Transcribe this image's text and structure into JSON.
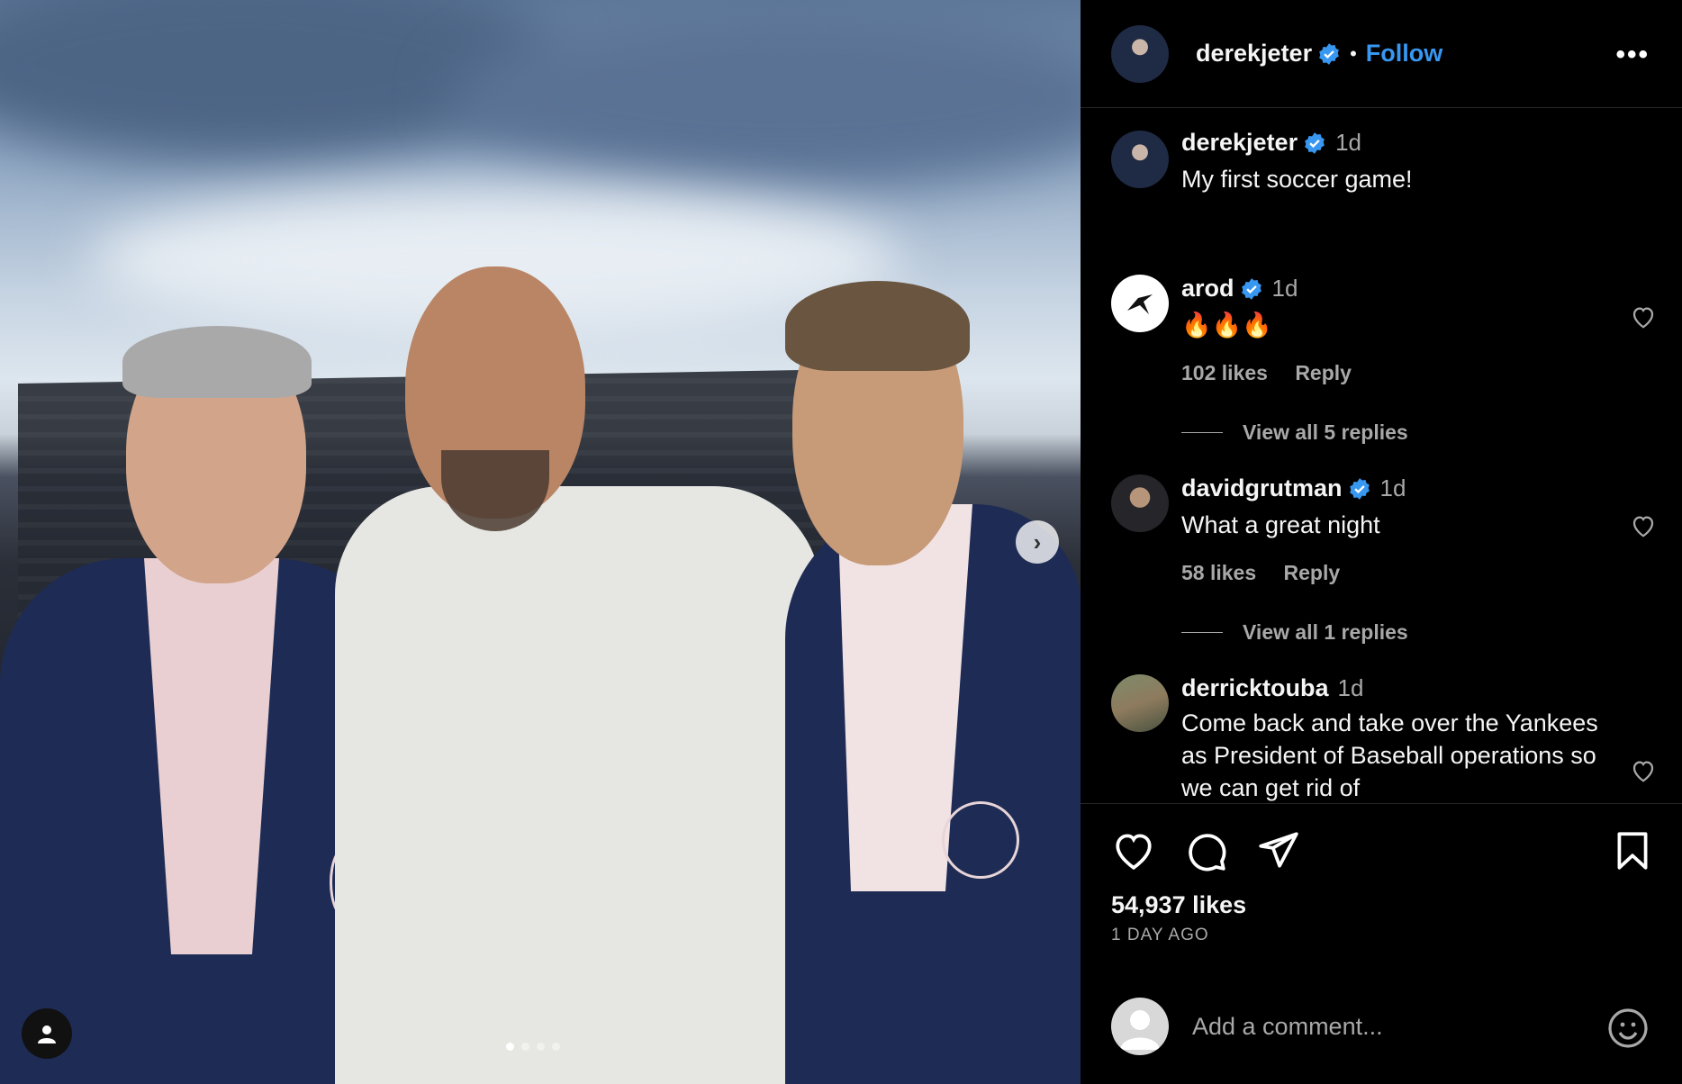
{
  "post": {
    "author": "derekjeter",
    "follow_label": "Follow",
    "bullet": "•",
    "more_label": "•••",
    "caption": {
      "username": "derekjeter",
      "time": "1d",
      "text": "My first soccer game!"
    },
    "likes": "54,937 likes",
    "date": "1 DAY AGO",
    "carousel": {
      "total": 4,
      "current": 1
    },
    "next_label": "›"
  },
  "comments": [
    {
      "username": "arod",
      "verified": true,
      "time": "1d",
      "text": "🔥🔥🔥",
      "likes": "102 likes",
      "reply_label": "Reply",
      "view_replies": "View all 5 replies"
    },
    {
      "username": "davidgrutman",
      "verified": true,
      "time": "1d",
      "text": "What a great night",
      "likes": "58 likes",
      "reply_label": "Reply",
      "view_replies": "View all 1 replies"
    },
    {
      "username": "derricktouba",
      "verified": false,
      "time": "1d",
      "text": "Come back and take over the Yankees as President of Baseball operations so we can get rid of"
    }
  ],
  "add_comment": {
    "placeholder": "Add a comment..."
  },
  "icons": {
    "like": "heart-icon",
    "comment": "comment-bubble-icon",
    "share": "paper-plane-icon",
    "save": "bookmark-icon",
    "emoji": "smiley-icon",
    "verified": "verified-badge-icon",
    "tag": "user-tag-icon"
  },
  "colors": {
    "accent": "#3897f0",
    "verified": "#3897f0",
    "background": "#000000",
    "muted": "#a8a8a8"
  }
}
